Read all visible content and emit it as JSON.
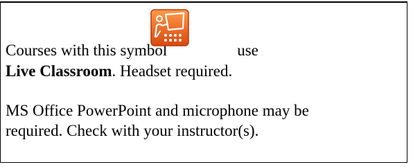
{
  "notice": {
    "line1_text": "Courses with this symbol",
    "line1_suffix": "use",
    "product_name": "Live Classroom",
    "line2_suffix": ".  Headset required.",
    "line3_text": "MS Office PowerPoint and microphone may be",
    "line4_text": "required. Check with your instructor(s).",
    "icon": {
      "name": "live-classroom-icon",
      "gradient_top": "#ff9a4a",
      "gradient_bottom": "#d9480f",
      "border": "#b83a08",
      "glyph_color": "#ffffff"
    }
  }
}
